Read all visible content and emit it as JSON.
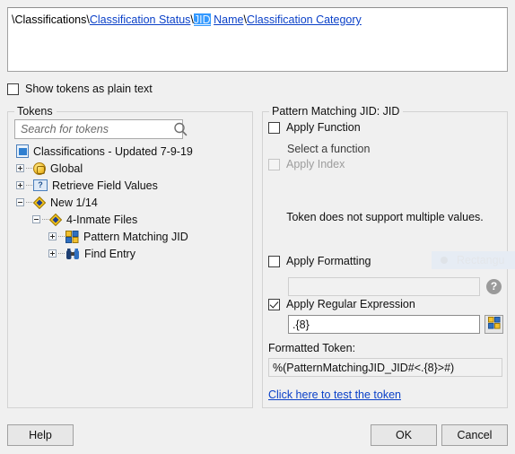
{
  "path_bar": {
    "segments": [
      {
        "text": "\\Classifications\\",
        "type": "plain"
      },
      {
        "text": "Classification Status",
        "type": "link"
      },
      {
        "text": "\\",
        "type": "plain"
      },
      {
        "text": "JID",
        "type": "link-selected"
      },
      {
        "text": " ",
        "type": "plain"
      },
      {
        "text": "Name",
        "type": "link"
      },
      {
        "text": "\\",
        "type": "plain"
      },
      {
        "text": "Classification Category",
        "type": "link"
      }
    ]
  },
  "options": {
    "show_plain_text_label": "Show tokens as plain text",
    "show_plain_text_checked": false
  },
  "tokens_panel": {
    "title": "Tokens",
    "search_placeholder": "Search for tokens",
    "search_value": "",
    "search_icon": "search-icon",
    "tree": [
      {
        "label": "Classifications - Updated 7-9-19",
        "icon": "document-icon",
        "depth": 0,
        "expander": "none"
      },
      {
        "label": "Global",
        "icon": "globe-icon",
        "depth": 1,
        "expander": "plus"
      },
      {
        "label": "Retrieve Field Values",
        "icon": "field-values-icon",
        "depth": 1,
        "expander": "plus"
      },
      {
        "label": "New 1/14",
        "icon": "diamond-icon",
        "depth": 1,
        "expander": "minus"
      },
      {
        "label": "4-Inmate Files",
        "icon": "diamond-icon",
        "depth": 2,
        "expander": "minus"
      },
      {
        "label": "Pattern Matching JID",
        "icon": "grid-icon",
        "depth": 3,
        "expander": "plus"
      },
      {
        "label": "Find Entry",
        "icon": "binoculars-icon",
        "depth": 3,
        "expander": "plus"
      }
    ]
  },
  "pattern_panel": {
    "title": "Pattern Matching JID: JID",
    "apply_function_label": "Apply Function",
    "apply_function_checked": false,
    "select_function_label": "Select a function",
    "apply_index_label": "Apply Index",
    "apply_index_checked": false,
    "apply_index_disabled": true,
    "multiple_values_message": "Token does not support multiple values.",
    "apply_formatting_label": "Apply Formatting",
    "apply_formatting_checked": false,
    "formatting_value": "",
    "help_icon_glyph": "?",
    "ghost_overlay_text": "Rectangu",
    "apply_regex_label": "Apply Regular Expression",
    "apply_regex_checked": true,
    "regex_value": ".{8}",
    "regex_builder_icon": "grid-icon",
    "formatted_token_label": "Formatted Token:",
    "formatted_token_value": "%(PatternMatchingJID_JID#<.{8}>#)",
    "test_token_link": "Click here to test the token"
  },
  "footer": {
    "help_label": "Help",
    "ok_label": "OK",
    "cancel_label": "Cancel"
  },
  "colors": {
    "link": "#0b41c8",
    "selection": "#3399ff",
    "dialog_bg": "#f0f0f0"
  }
}
